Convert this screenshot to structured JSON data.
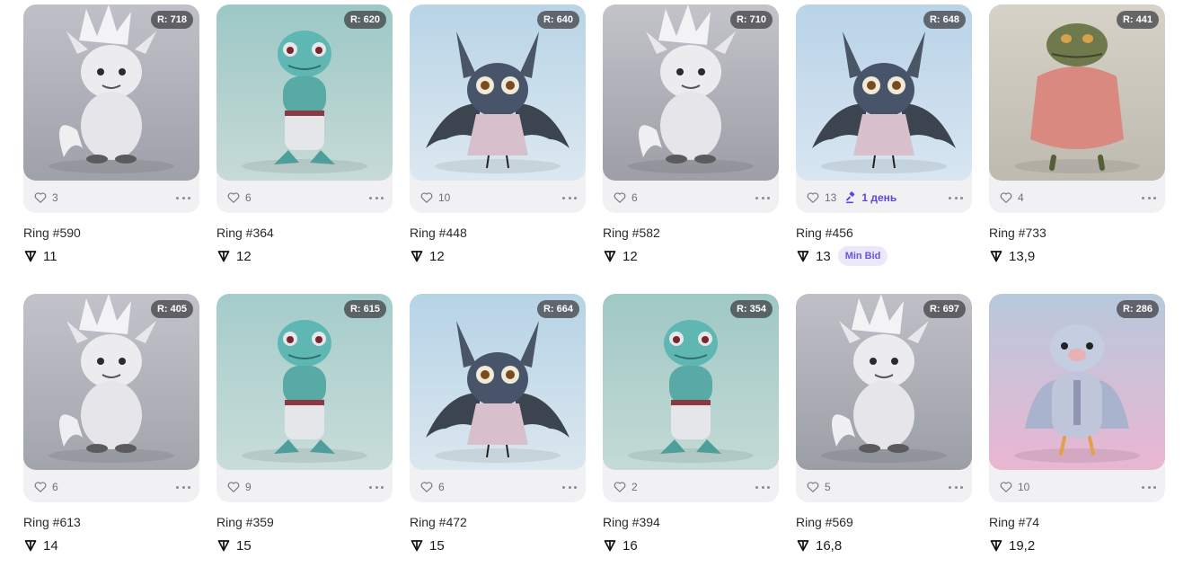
{
  "colors": {
    "accent": "#5c48d6",
    "badge_bg": "#3c3c40",
    "card_bg": "#f1f1f4"
  },
  "icons": {
    "like": "heart-icon",
    "more": "more-dots-icon",
    "currency": "ton-icon",
    "auction": "gavel-icon"
  },
  "items": [
    {
      "rank": "R: 718",
      "likes": "3",
      "name": "Ring #590",
      "price": "11",
      "bg1": "#bfc0c8",
      "bg2": "#9fa1aa",
      "creature": "furball"
    },
    {
      "rank": "R: 620",
      "likes": "6",
      "name": "Ring #364",
      "price": "12",
      "bg1": "#9cc8c6",
      "bg2": "#c7dad7",
      "creature": "lizard"
    },
    {
      "rank": "R: 640",
      "likes": "10",
      "name": "Ring #448",
      "price": "12",
      "bg1": "#b8d4e6",
      "bg2": "#dce8f0",
      "creature": "bat"
    },
    {
      "rank": "R: 710",
      "likes": "6",
      "name": "Ring #582",
      "price": "12",
      "bg1": "#c3c3ca",
      "bg2": "#9d9ea6",
      "creature": "furball"
    },
    {
      "rank": "R: 648",
      "likes": "13",
      "name": "Ring #456",
      "price": "13",
      "bg1": "#b9d3e8",
      "bg2": "#d8e6f1",
      "creature": "bat",
      "auction": "1 день",
      "badge": "Min Bid"
    },
    {
      "rank": "R: 441",
      "likes": "4",
      "name": "Ring #733",
      "price": "13,9",
      "bg1": "#d6d2c8",
      "bg2": "#bfbab0",
      "creature": "toad"
    },
    {
      "rank": "R: 405",
      "likes": "6",
      "name": "Ring #613",
      "price": "14",
      "bg1": "#c2c3ca",
      "bg2": "#a2a4ac",
      "creature": "furball"
    },
    {
      "rank": "R: 615",
      "likes": "9",
      "name": "Ring #359",
      "price": "15",
      "bg1": "#a4cccb",
      "bg2": "#c9ddd9",
      "creature": "lizard"
    },
    {
      "rank": "R: 664",
      "likes": "6",
      "name": "Ring #472",
      "price": "15",
      "bg1": "#b6d3e6",
      "bg2": "#dbe7ef",
      "creature": "bat"
    },
    {
      "rank": "R: 354",
      "likes": "2",
      "name": "Ring #394",
      "price": "16",
      "bg1": "#9fc8c4",
      "bg2": "#c4dad6",
      "creature": "lizard"
    },
    {
      "rank": "R: 697",
      "likes": "5",
      "name": "Ring #569",
      "price": "16,8",
      "bg1": "#bfc0c7",
      "bg2": "#9c9ea6",
      "creature": "furball"
    },
    {
      "rank": "R: 286",
      "likes": "10",
      "name": "Ring #74",
      "price": "19,2",
      "bg1": "#b7c9dc",
      "bg2": "#eab6d2",
      "creature": "bird"
    }
  ]
}
